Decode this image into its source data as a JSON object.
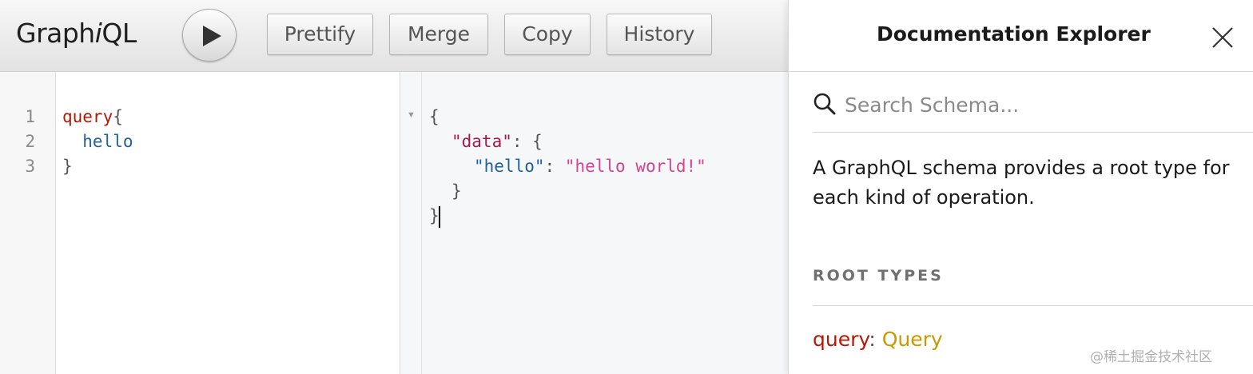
{
  "toolbar": {
    "logo_prefix": "Graph",
    "logo_italic": "i",
    "logo_suffix": "QL",
    "buttons": {
      "prettify": "Prettify",
      "merge": "Merge",
      "copy": "Copy",
      "history": "History"
    },
    "run_icon": "play-icon"
  },
  "query_editor": {
    "line_numbers": [
      "1",
      "2",
      "3"
    ],
    "lines": {
      "l1_keyword": "query",
      "l1_brace": "{",
      "l2_field": "  hello",
      "l3_brace": "}"
    }
  },
  "result": {
    "fold_icon": "fold-arrow-icon",
    "open_brace": "{",
    "data_key": "\"data\"",
    "data_sep": ": {",
    "hello_key": "\"hello\"",
    "hello_sep": ": ",
    "hello_value": "\"hello world!\"",
    "inner_close": "}",
    "outer_close": "}"
  },
  "docs": {
    "title": "Documentation Explorer",
    "close_icon": "close-icon",
    "search_icon": "search-icon",
    "search_placeholder": "Search Schema...",
    "description": "A GraphQL schema provides a root type for each kind of operation.",
    "section_title": "ROOT TYPES",
    "root_types": [
      {
        "name": "query",
        "separator": ": ",
        "type": "Query"
      }
    ]
  },
  "watermark": "@稀土掘金技术社区",
  "colors": {
    "keyword": "#b11a04",
    "field": "#1f61a0",
    "string_key": "#a11a4e",
    "string_value": "#d64292",
    "type_link": "#ca9800"
  }
}
